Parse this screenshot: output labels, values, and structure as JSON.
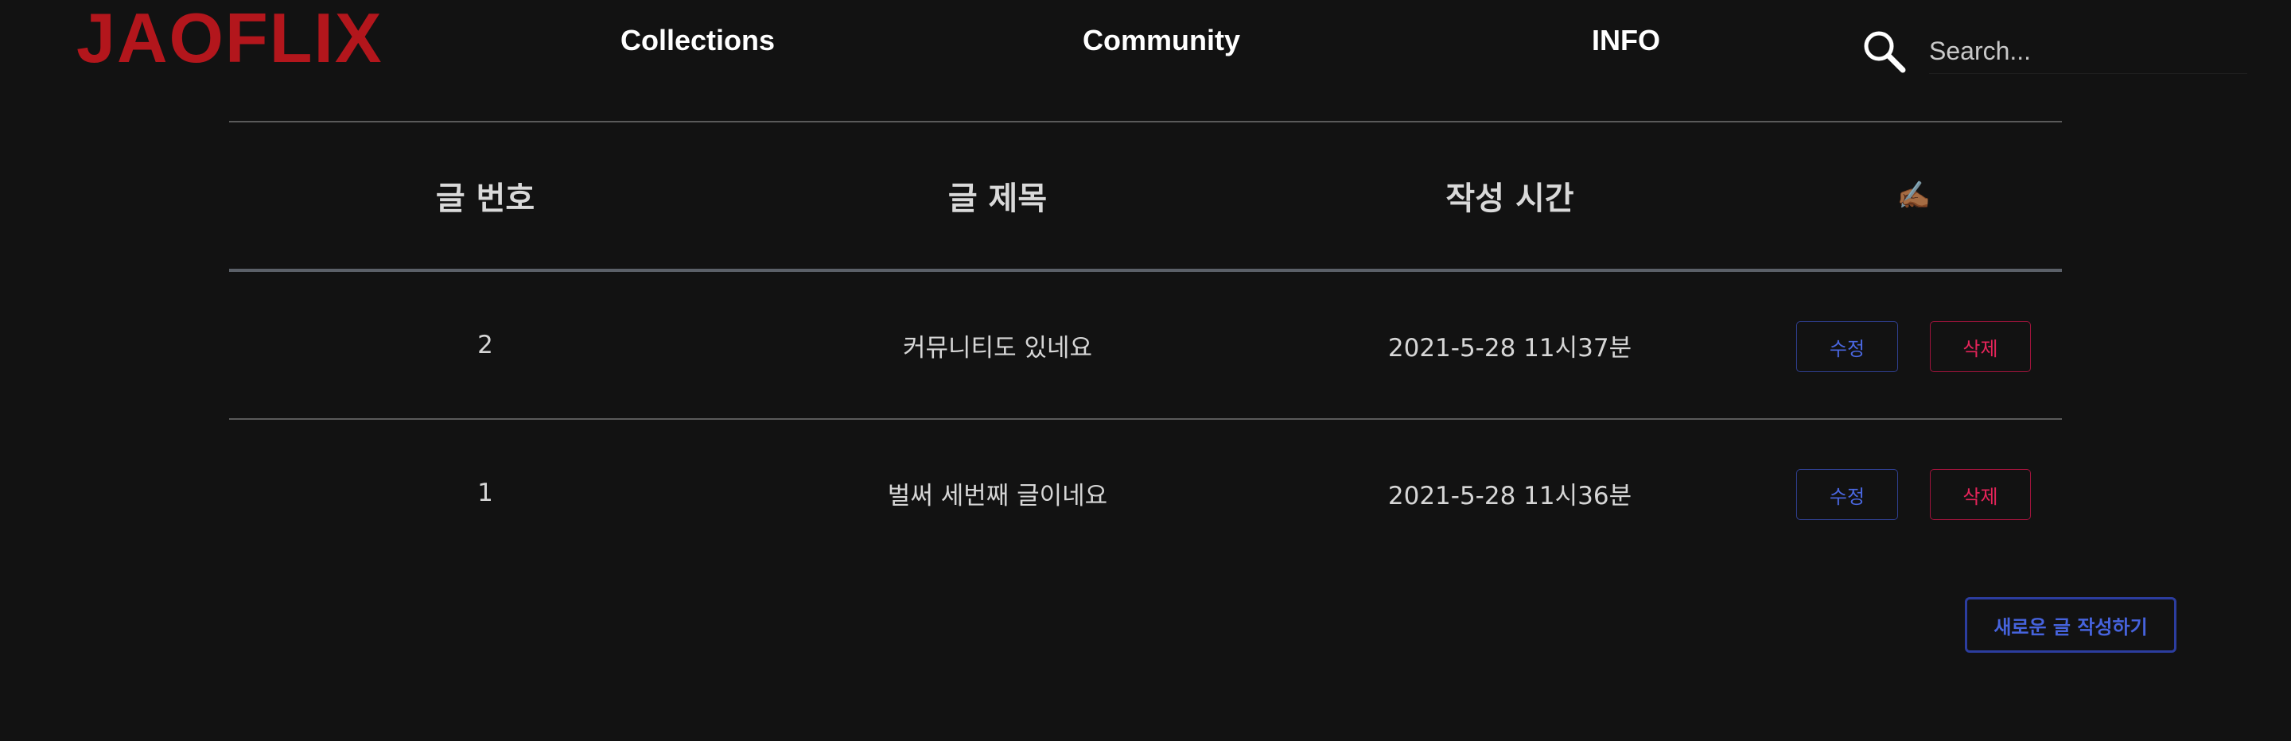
{
  "header": {
    "logo": "JAOFLIX",
    "nav": [
      {
        "label": "Collections"
      },
      {
        "label": "Community"
      },
      {
        "label": "INFO"
      }
    ],
    "search": {
      "placeholder": "Search...",
      "value": ""
    }
  },
  "board": {
    "columns": [
      "글 번호",
      "글 제목",
      "작성 시간",
      "✍🏾"
    ],
    "rows": [
      {
        "number": "2",
        "title": "커뮤니티도 있네요",
        "time": "2021-5-28 11시37분",
        "edit_label": "수정",
        "delete_label": "삭제"
      },
      {
        "number": "1",
        "title": "벌써 세번째 글이네요",
        "time": "2021-5-28 11시36분",
        "edit_label": "수정",
        "delete_label": "삭제"
      }
    ],
    "new_post_label": "새로운 글 작성하기"
  },
  "colors": {
    "background": "#121212",
    "logo": "#b3161c",
    "edit_accent": "#4a67e0",
    "delete_accent": "#e6245a",
    "new_post_accent": "#4663dd"
  },
  "icons": {
    "search": "search-icon",
    "writing_hand": "writing-hand-icon"
  }
}
